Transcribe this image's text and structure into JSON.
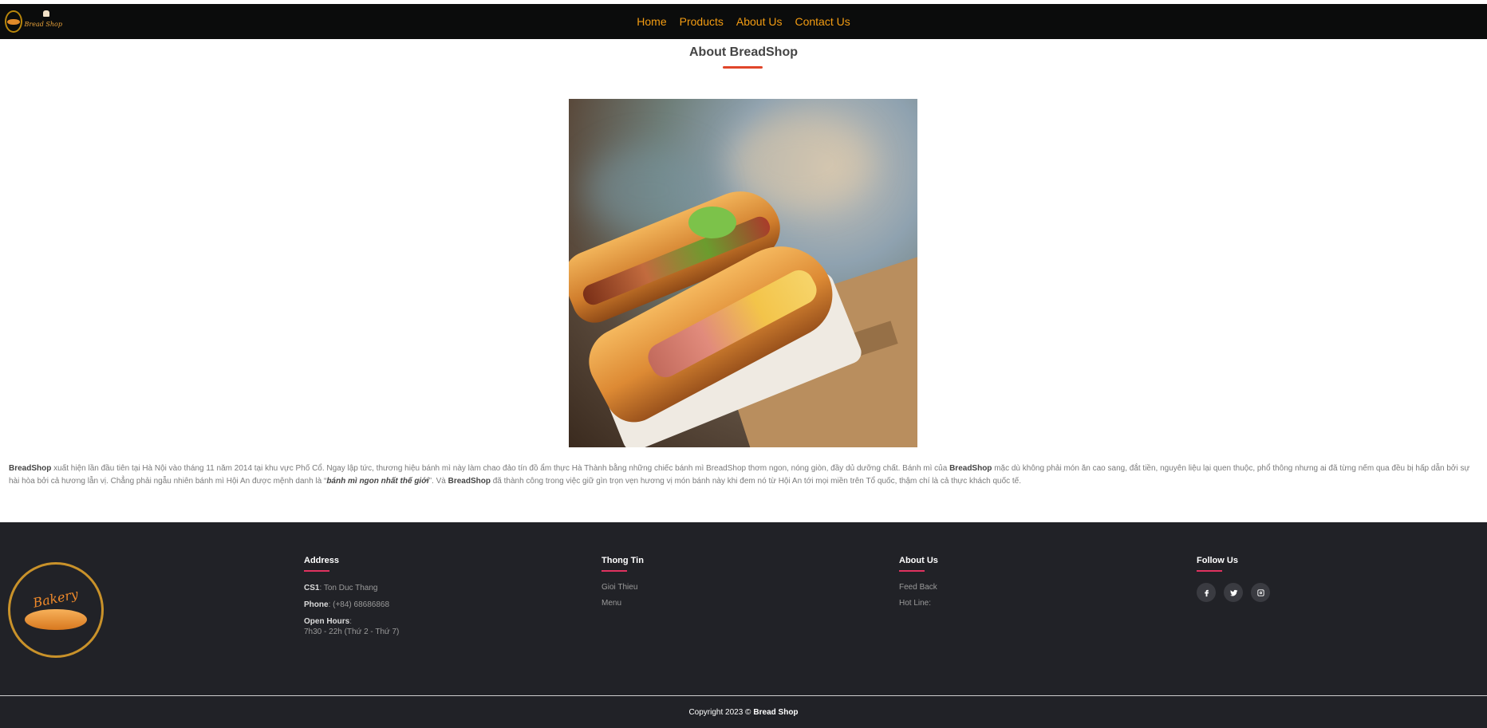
{
  "nav": {
    "logo_text": "Bread Shop",
    "links": [
      "Home",
      "Products",
      "About Us",
      "Contact Us"
    ]
  },
  "about": {
    "title": "About BreadShop",
    "paragraph": {
      "brand": "BreadShop",
      "t1": " xuất hiện lần đầu tiên tại Hà Nội vào tháng 11 năm 2014 tại khu vực Phố Cổ. Ngay lập tức, thương hiệu bánh mì này làm chao đảo tín đồ ẩm thực Hà Thành bằng những chiếc bánh mì BreadShop thơm ngon, nóng giòn, đầy dủ dưỡng chất. Bánh mì của ",
      "brand2": "BreadShop",
      "t2": " mặc dù không phải món ăn cao sang, đắt tiền, nguyên liệu lại quen thuộc, phổ thông nhưng ai đã từng nếm qua đều bị hấp dẫn bởi sự hài hòa bởi cả hương lẫn vị. Chẳng phải ngẫu nhiên bánh mì Hội An được mệnh danh là “",
      "quote": "bánh mì ngon nhất thế giới",
      "t3": "”. Và ",
      "brand3": "BreadShop",
      "t4": " đã thành công trong việc giữ gìn trọn vẹn hương vị món bánh này khi đem nó từ Hội An tới mọi miền trên Tổ quốc, thậm chí là cả thực khách quốc tế."
    }
  },
  "footer": {
    "logo_text": "Bakery",
    "address": {
      "heading": "Address",
      "cs_label": "CS1",
      "cs_value": ": Ton Duc Thang",
      "phone_label": "Phone",
      "phone_value": ": (+84) 68686868",
      "hours_label": "Open Hours",
      "hours_colon": ":",
      "hours_value": "7h30 - 22h (Thứ 2 - Thứ 7)"
    },
    "thongtin": {
      "heading": "Thong Tin",
      "links": [
        "Gioi Thieu",
        "Menu"
      ]
    },
    "aboutus": {
      "heading": "About Us",
      "links": [
        "Feed Back",
        "Hot Line:"
      ]
    },
    "follow": {
      "heading": "Follow Us",
      "icons": [
        "facebook-icon",
        "twitter-icon",
        "instagram-icon"
      ]
    },
    "copyright_prefix": "Copyright 2023 ©",
    "copyright_brand": "Bread Shop"
  },
  "colors": {
    "nav_bg": "#0b0c0c",
    "nav_link": "#f39c12",
    "accent_title": "#e0452a",
    "footer_bg": "#212227",
    "footer_underline": "#e0325f"
  }
}
